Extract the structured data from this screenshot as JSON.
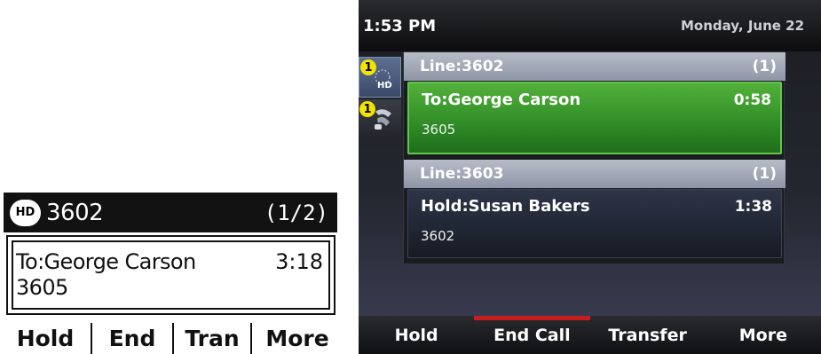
{
  "lcd_phone": {
    "hd_label": "HD",
    "line": "3602",
    "call_count": "(1/2)",
    "call": {
      "party": "To:George Carson",
      "duration": "3:18",
      "number": "3605"
    },
    "softkeys": [
      "Hold",
      "End",
      "Tran",
      "More"
    ]
  },
  "color_phone": {
    "time": "1:53 PM",
    "date": "Monday, June 22",
    "side_tabs": [
      {
        "badge": "1",
        "icon": "hd-line-icon"
      },
      {
        "badge": "1",
        "icon": "handset-icon"
      }
    ],
    "lines": [
      {
        "label": "Line:3602",
        "count": "(1)",
        "call": {
          "party": "To:George Carson",
          "duration": "0:58",
          "number": "3605",
          "state": "active"
        }
      },
      {
        "label": "Line:3603",
        "count": "(1)",
        "call": {
          "party": "Hold:Susan Bakers",
          "duration": "1:38",
          "number": "3602",
          "state": "hold"
        }
      }
    ],
    "softkeys": [
      "Hold",
      "End Call",
      "Transfer",
      "More"
    ],
    "colors": {
      "active_call": "#3a9a2c",
      "end_call_accent": "#c81d1d",
      "badge": "#f2e300"
    }
  }
}
